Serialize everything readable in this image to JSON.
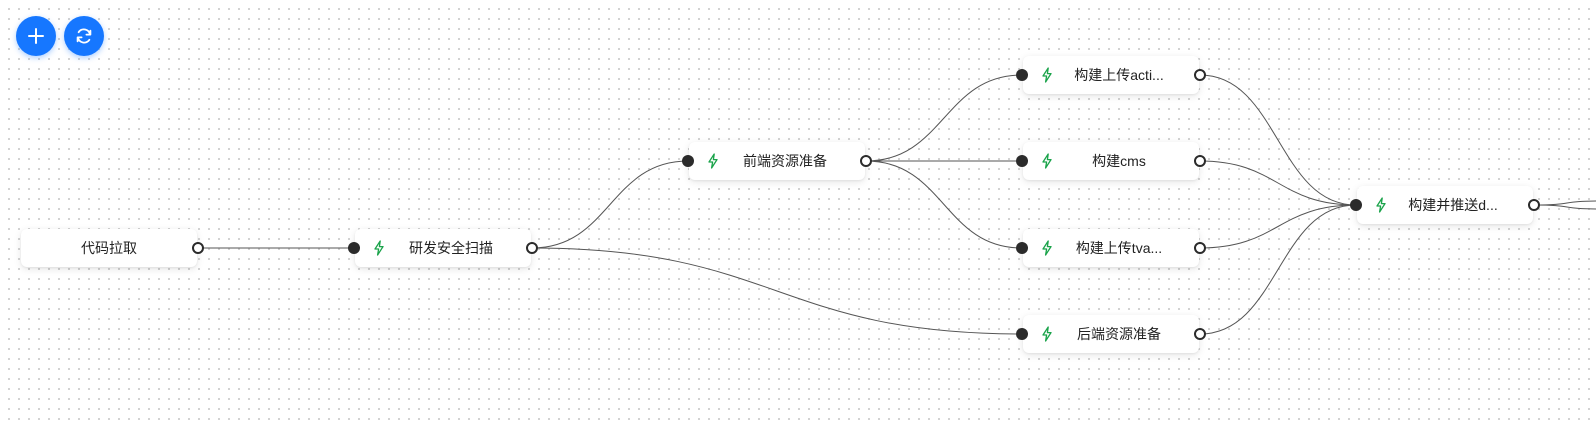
{
  "toolbar": {
    "add_icon": "plus-icon",
    "refresh_icon": "refresh-icon",
    "accent_color": "#1677ff"
  },
  "colors": {
    "line": "#555555",
    "bolt": "#1aa34a",
    "port": "#2b2b2b"
  },
  "nodes": [
    {
      "id": "n1",
      "label": "代码拉取",
      "icon": null
    },
    {
      "id": "n2",
      "label": "研发安全扫描",
      "icon": "lightning-icon"
    },
    {
      "id": "n3",
      "label": "前端资源准备",
      "icon": "lightning-icon"
    },
    {
      "id": "n4",
      "label": "构建上传acti...",
      "icon": "lightning-icon"
    },
    {
      "id": "n5",
      "label": "构建cms",
      "icon": "lightning-icon"
    },
    {
      "id": "n6",
      "label": "构建上传tva...",
      "icon": "lightning-icon"
    },
    {
      "id": "n7",
      "label": "后端资源准备",
      "icon": "lightning-icon"
    },
    {
      "id": "n8",
      "label": "构建并推送d...",
      "icon": "lightning-icon"
    }
  ],
  "edges": [
    {
      "from": "n1",
      "to": "n2"
    },
    {
      "from": "n2",
      "to": "n3"
    },
    {
      "from": "n2",
      "to": "n7"
    },
    {
      "from": "n3",
      "to": "n4"
    },
    {
      "from": "n3",
      "to": "n5"
    },
    {
      "from": "n3",
      "to": "n6"
    },
    {
      "from": "n4",
      "to": "n8"
    },
    {
      "from": "n5",
      "to": "n8"
    },
    {
      "from": "n6",
      "to": "n8"
    },
    {
      "from": "n7",
      "to": "n8"
    },
    {
      "from": "n8",
      "to": null
    },
    {
      "from": "n8",
      "to": null
    }
  ]
}
